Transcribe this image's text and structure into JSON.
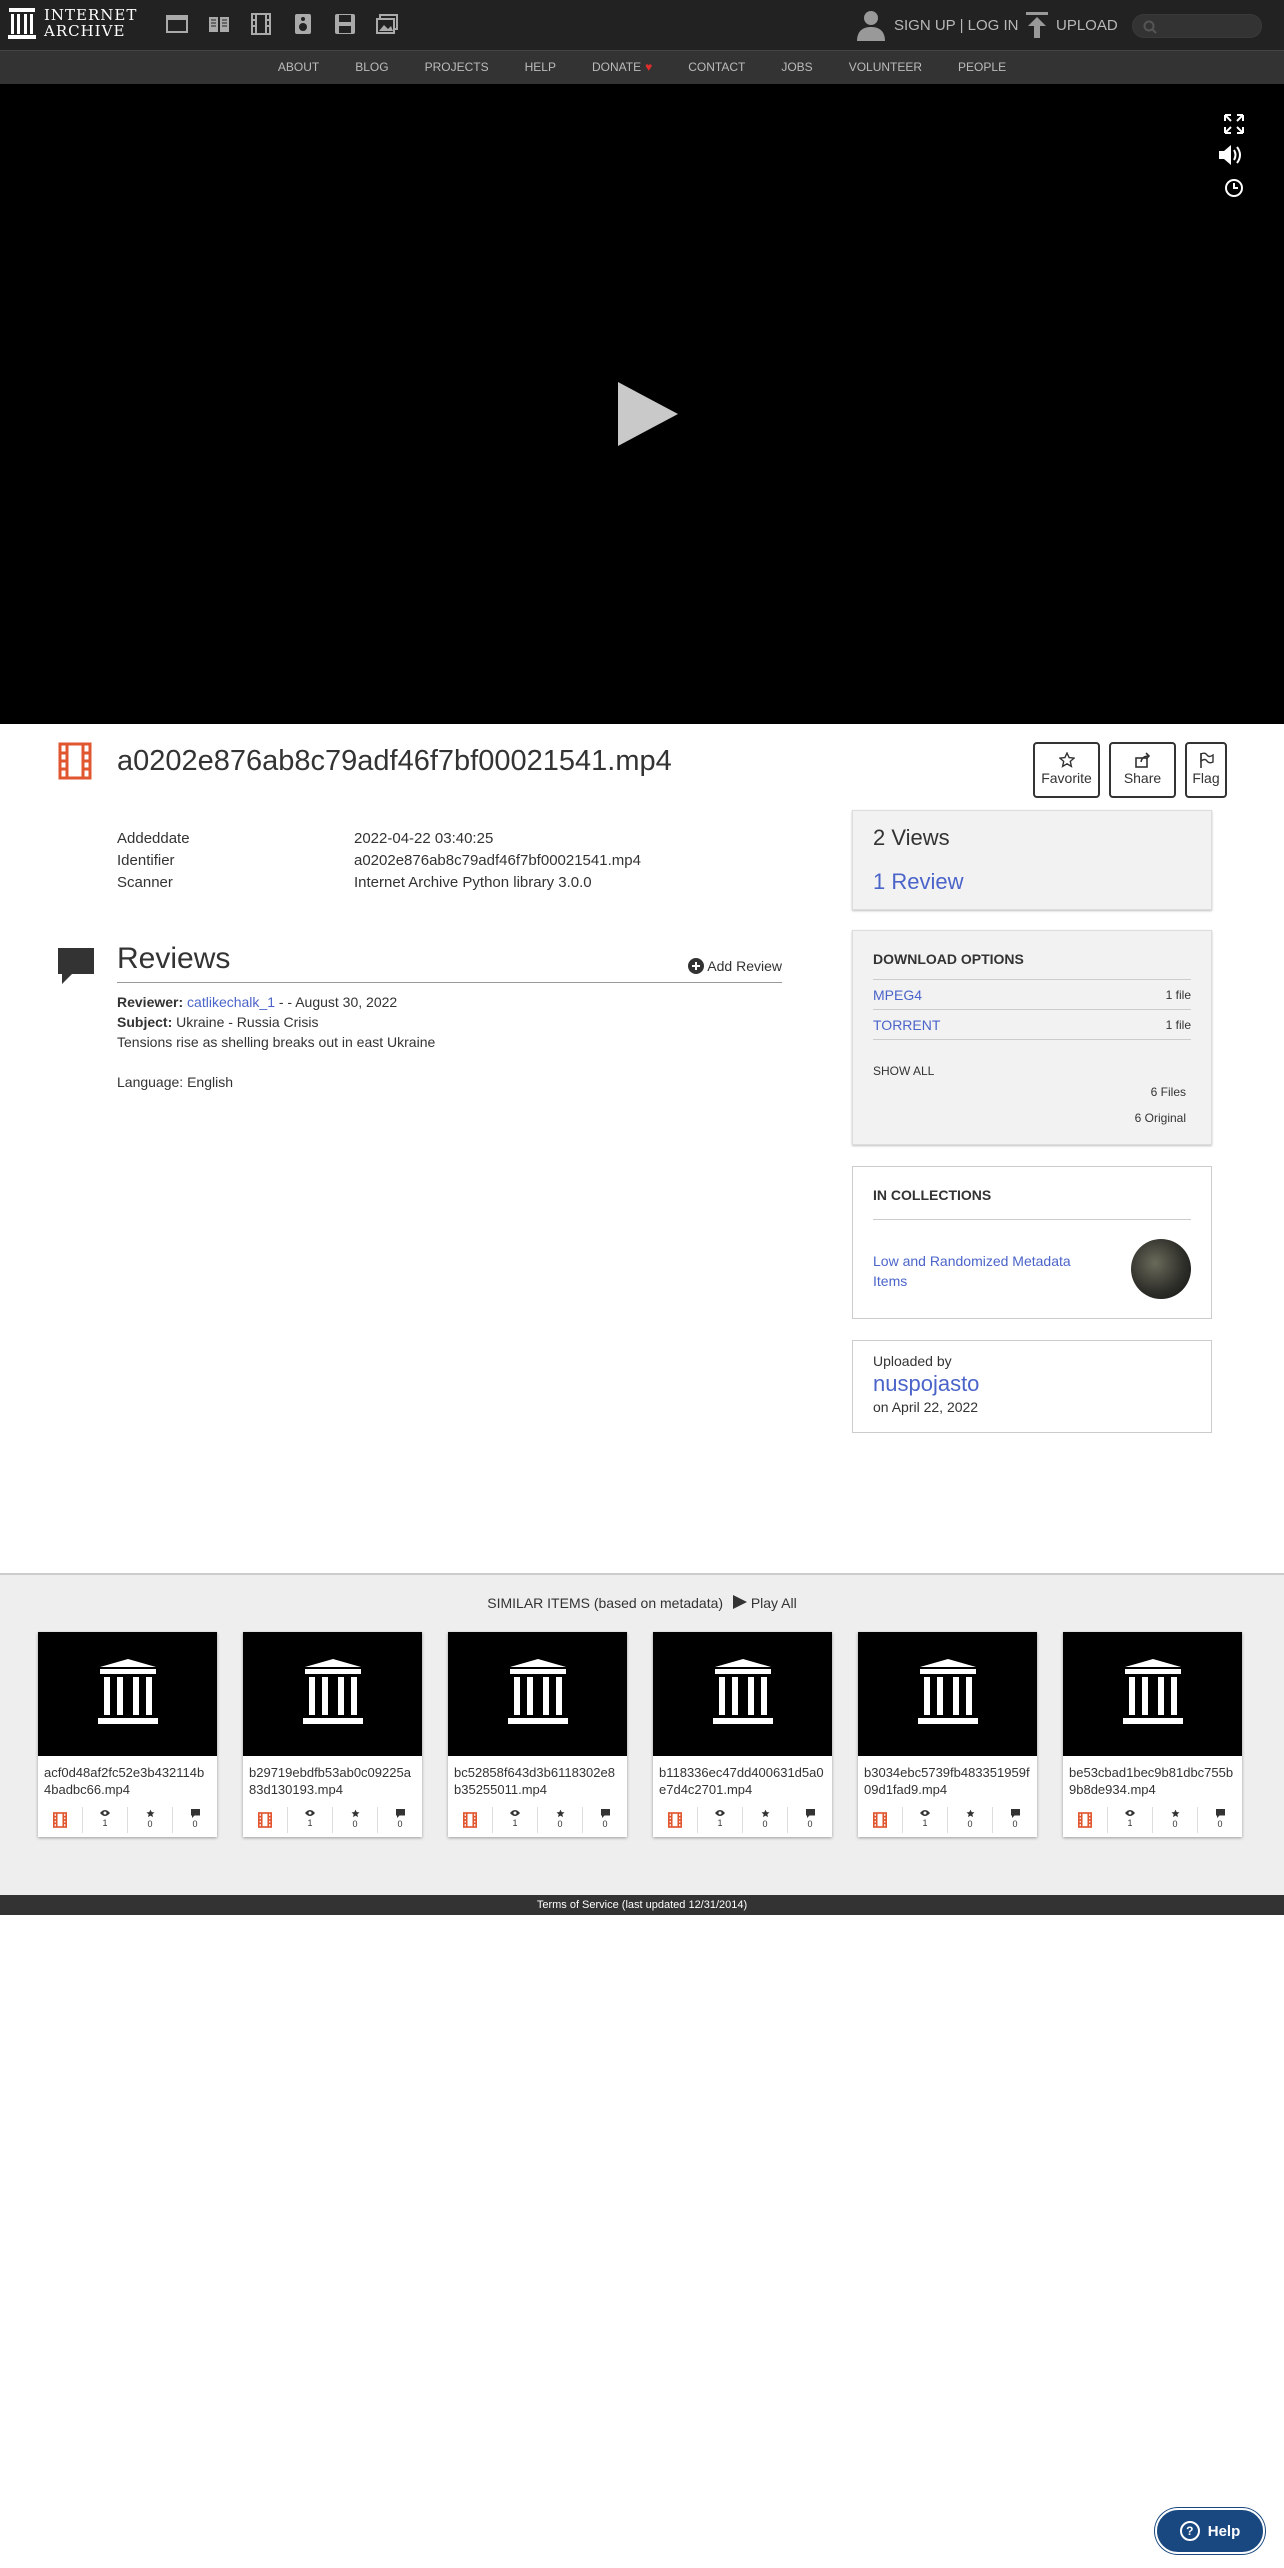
{
  "header": {
    "logo_line1": "INTERNET",
    "logo_line2": "ARCHIVE",
    "media_icons": [
      "web-icon",
      "texts-icon",
      "video-icon",
      "audio-icon",
      "software-icon",
      "images-icon"
    ],
    "auth_label": "SIGN UP | LOG IN",
    "upload_label": "UPLOAD",
    "search_placeholder": "Search"
  },
  "nav": {
    "items": [
      "ABOUT",
      "BLOG",
      "PROJECTS",
      "HELP",
      "DONATE",
      "CONTACT",
      "JOBS",
      "VOLUNTEER",
      "PEOPLE"
    ]
  },
  "item": {
    "title": "a0202e876ab8c79adf46f7bf00021541.mp4",
    "actions": {
      "favorite": "Favorite",
      "share": "Share",
      "flag": "Flag"
    },
    "metadata": [
      {
        "key": "Addeddate",
        "value": "2022-04-22 03:40:25"
      },
      {
        "key": "Identifier",
        "value": "a0202e876ab8c79adf46f7bf00021541.mp4"
      },
      {
        "key": "Scanner",
        "value": "Internet Archive Python library 3.0.0"
      }
    ]
  },
  "reviews": {
    "heading": "Reviews",
    "add_label": "Add Review",
    "reviewer_label": "Reviewer:",
    "reviewer": "catlikechalk_1",
    "date": " - - August 30, 2022",
    "subject_label": "Subject:",
    "subject": "Ukraine - Russia Crisis",
    "body": "Tensions rise as shelling breaks out in east Ukraine",
    "language": "Language: English"
  },
  "sidebar": {
    "views": "2 Views",
    "reviews_count": "1 Review",
    "download": {
      "heading": "DOWNLOAD OPTIONS",
      "rows": [
        {
          "format": "MPEG4",
          "count": "1 file"
        },
        {
          "format": "TORRENT",
          "count": "1 file"
        }
      ],
      "show_all": "SHOW ALL",
      "files": "6 Files",
      "original": "6 Original"
    },
    "collections": {
      "heading": "IN COLLECTIONS",
      "link": "Low and Randomized Metadata Items"
    },
    "uploaded": {
      "label": "Uploaded by",
      "user": "nuspojasto",
      "date": "on April 22, 2022"
    }
  },
  "similar": {
    "heading": "SIMILAR ITEMS (based on metadata)",
    "play_all": "Play All",
    "cards": [
      {
        "name": "acf0d48af2fc52e3b432114b4badbc66.mp4",
        "views": "1",
        "favs": "0",
        "reviews": "0"
      },
      {
        "name": "b29719ebdfb53ab0c09225a83d130193.mp4",
        "views": "1",
        "favs": "0",
        "reviews": "0"
      },
      {
        "name": "bc52858f643d3b6118302e8b35255011.mp4",
        "views": "1",
        "favs": "0",
        "reviews": "0"
      },
      {
        "name": "b118336ec47dd400631d5a0e7d4c2701.mp4",
        "views": "1",
        "favs": "0",
        "reviews": "0"
      },
      {
        "name": "b3034ebc5739fb483351959f09d1fad9.mp4",
        "views": "1",
        "favs": "0",
        "reviews": "0"
      },
      {
        "name": "be53cbad1bec9b81dbc755b9b8de934.mp4",
        "views": "1",
        "favs": "0",
        "reviews": "0"
      }
    ]
  },
  "footer": {
    "terms": "Terms of Service (last updated 12/31/2014)"
  },
  "help_label": "Help",
  "colors": {
    "accent": "#4b64c9",
    "video_icon": "#e0562f",
    "topbar": "#222222",
    "help": "#194880"
  }
}
